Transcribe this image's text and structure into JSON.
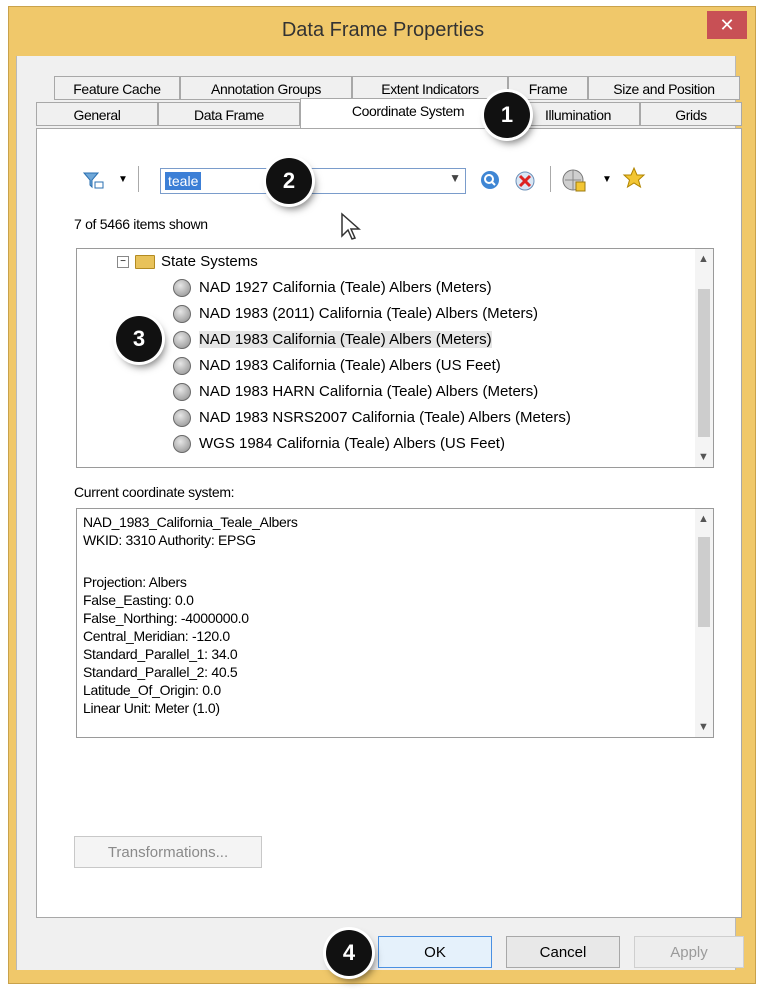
{
  "window": {
    "title": "Data Frame Properties",
    "close_glyph": "✕"
  },
  "tabs": {
    "row1": [
      "Feature Cache",
      "Annotation Groups",
      "Extent Indicators",
      "Frame",
      "Size and Position"
    ],
    "row2": [
      "General",
      "Data Frame",
      "Coordinate System",
      "Illumination",
      "Grids"
    ],
    "active": "Coordinate System"
  },
  "toolbar": {
    "filter_icon": "filter-icon",
    "search_value": "teale",
    "search_icon": "search-icon",
    "clear_icon": "clear-search-icon",
    "globe_icon": "globe-add-icon",
    "favorite_icon": "favorite-star-icon"
  },
  "list": {
    "count_text": "7 of 5466 items shown",
    "folder": "State Systems",
    "items": [
      "NAD 1927 California (Teale) Albers (Meters)",
      "NAD 1983 (2011) California (Teale) Albers (Meters)",
      "NAD 1983 California (Teale) Albers (Meters)",
      "NAD 1983 California (Teale) Albers (US Feet)",
      "NAD 1983 HARN California (Teale) Albers (Meters)",
      "NAD 1983 NSRS2007 California (Teale) Albers (Meters)",
      "WGS 1984 California (Teale) Albers (US Feet)"
    ],
    "selected_index": 2
  },
  "current": {
    "label": "Current coordinate system:",
    "lines": [
      "NAD_1983_California_Teale_Albers",
      "WKID: 3310 Authority: EPSG",
      "",
      "Projection: Albers",
      "False_Easting: 0.0",
      "False_Northing: -4000000.0",
      "Central_Meridian: -120.0",
      "Standard_Parallel_1: 34.0",
      "Standard_Parallel_2: 40.5",
      "Latitude_Of_Origin: 0.0",
      "Linear Unit: Meter (1.0)"
    ]
  },
  "buttons": {
    "transformations": "Transformations...",
    "ok": "OK",
    "cancel": "Cancel",
    "apply": "Apply"
  },
  "callouts": [
    "1",
    "2",
    "3",
    "4"
  ],
  "colors": {
    "accent": "#3c7fd6",
    "titlebar": "#f0c86a",
    "close": "#c85055"
  }
}
